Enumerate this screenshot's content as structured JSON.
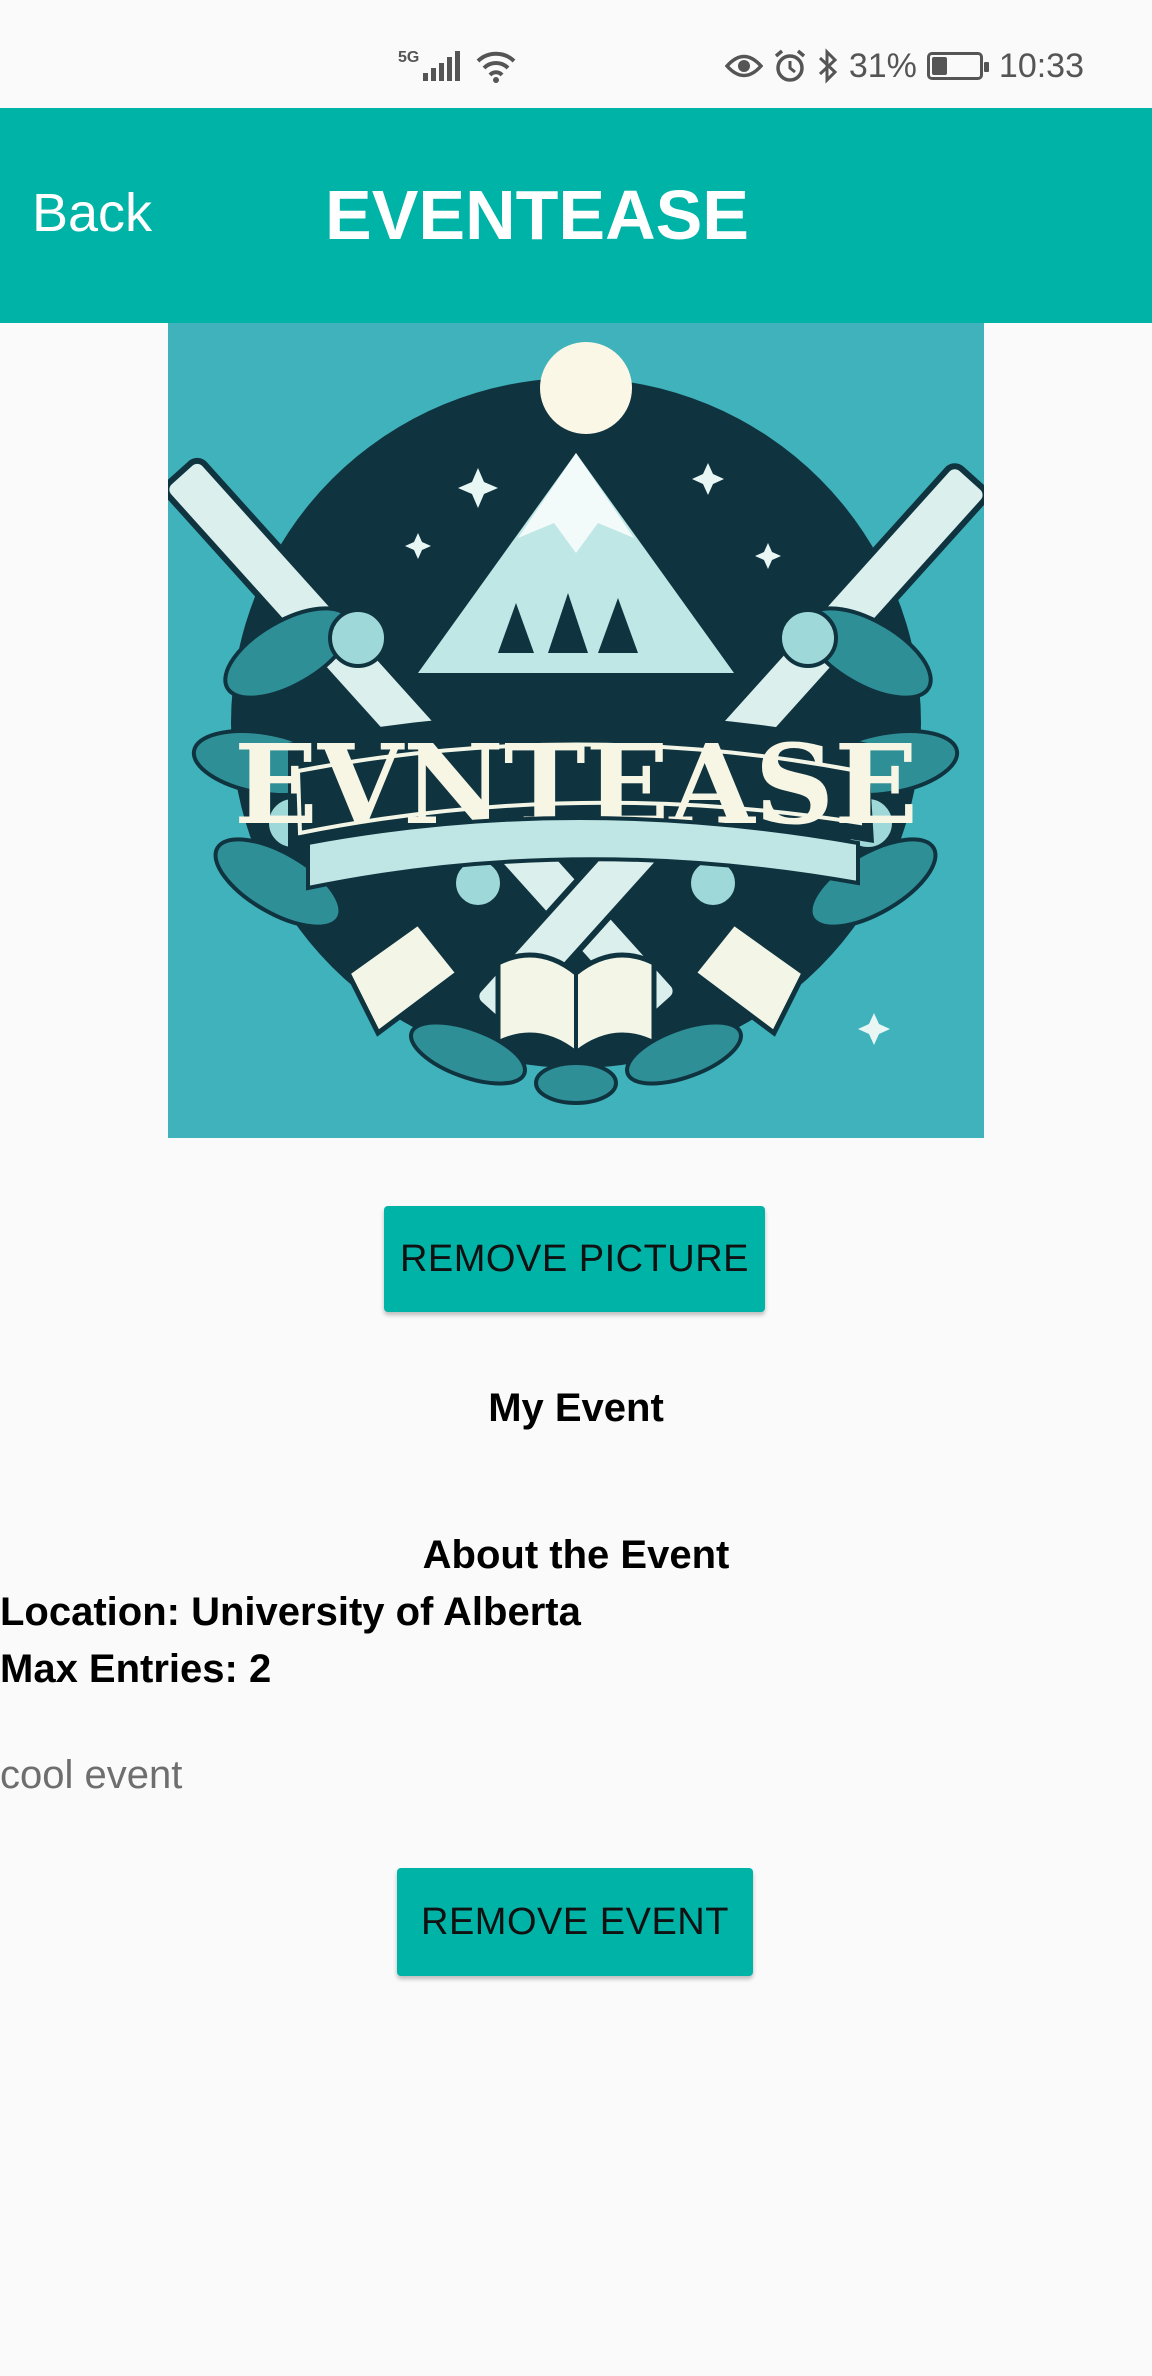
{
  "status_bar": {
    "network_label": "5G",
    "battery_percent": "31%",
    "battery_level": 0.31,
    "time": "10:33",
    "icons": [
      "signal-icon",
      "wifi-icon",
      "eye-icon",
      "alarm-icon",
      "bluetooth-icon",
      "battery-icon"
    ]
  },
  "header": {
    "back_label": "Back",
    "title": "EVENTEASE"
  },
  "event_image": {
    "logo_text": "EVNTEASE"
  },
  "buttons": {
    "remove_picture": "REMOVE PICTURE",
    "remove_event": "REMOVE EVENT"
  },
  "event": {
    "name": "My Event",
    "about_title": "About the Event",
    "location": "Location: University of Alberta",
    "max_entries": "Max Entries: 2",
    "description": "cool event"
  },
  "colors": {
    "accent": "#00b3a7",
    "background": "#fafafa",
    "image_background": "#40b2bb"
  }
}
